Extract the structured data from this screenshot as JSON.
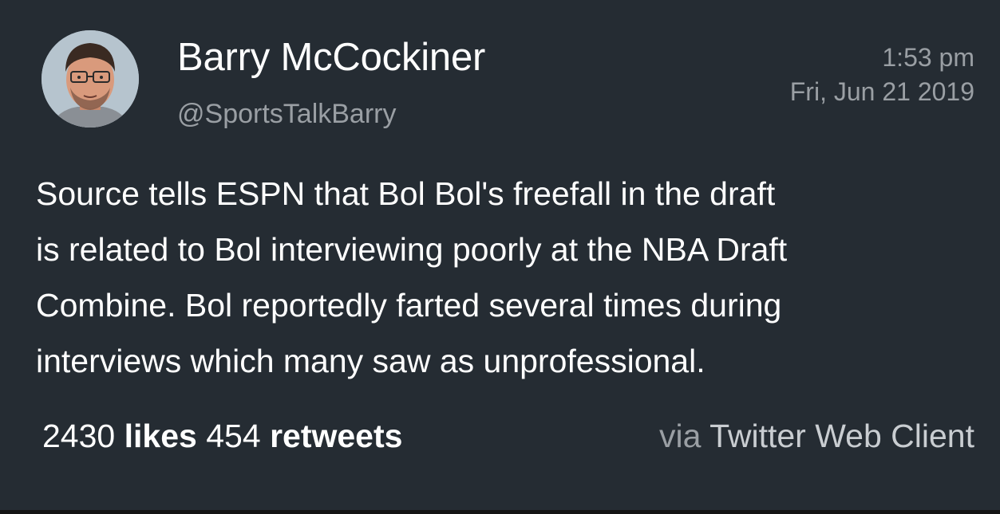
{
  "user": {
    "display_name": "Barry McCockiner",
    "handle": "@SportsTalkBarry",
    "avatar_icon": "profile-photo"
  },
  "timestamp": {
    "time": "1:53 pm",
    "date": "Fri, Jun 21 2019"
  },
  "tweet": {
    "lines": [
      "Source tells ESPN that Bol Bol's freefall in the draft",
      "is related to Bol interviewing poorly at the NBA Draft",
      "Combine. Bol reportedly farted several times during",
      "interviews which many saw as unprofessional."
    ]
  },
  "stats": {
    "likes_count": "2430",
    "likes_label": "likes",
    "retweets_count": "454",
    "retweets_label": "retweets"
  },
  "source": {
    "prefix": "via",
    "client": "Twitter Web Client"
  },
  "colors": {
    "background": "#252c33",
    "primary_text": "#ffffff",
    "secondary_text": "#9a9fa4"
  }
}
